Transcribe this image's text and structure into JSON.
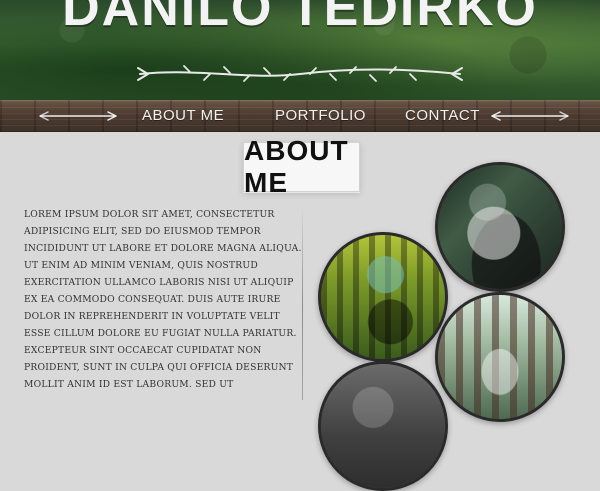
{
  "header": {
    "site_title": "DANILO TEDIRKO"
  },
  "nav": {
    "items": [
      {
        "label": "ABOUT ME"
      },
      {
        "label": "PORTFOLIO"
      },
      {
        "label": "CONTACT"
      }
    ]
  },
  "about": {
    "title": "ABOUT ME",
    "paragraph": "Lorem ipsum dolor sit amet, consectetur adipisicing elit, sed do eiusmod tempor incididunt ut labore et dolore magna aliqua. Ut enim ad minim veniam, quis nostrud exercitation ullamco laboris nisi ut aliquip ex ea commodo consequat. Duis aute irure dolor in reprehenderit in voluptate velit esse cillum dolore eu fugiat nulla pariatur. Excepteur sint occaecat cupidatat non proident, sunt in culpa qui officia deserunt mollit anim id est laborum. Sed ut perspiciatis unde omnis iste natus error sit voluptatem accusantium doloremque laudantium, totam rem aperiam, eaque ipsa quae ab illo inventore veritatis et quasi architecto beatae vitae dicta sunt explicabo. Nemo enim ipsam"
  },
  "icons": {
    "vine": "vine-divider-icon",
    "arrow_left": "arrow-left-icon",
    "arrow_right": "arrow-right-icon"
  },
  "colors": {
    "page_bg": "#d9d9d9",
    "title_text": "#f3f3f3",
    "nav_text": "#f1f1f1",
    "body_text": "#333333"
  }
}
